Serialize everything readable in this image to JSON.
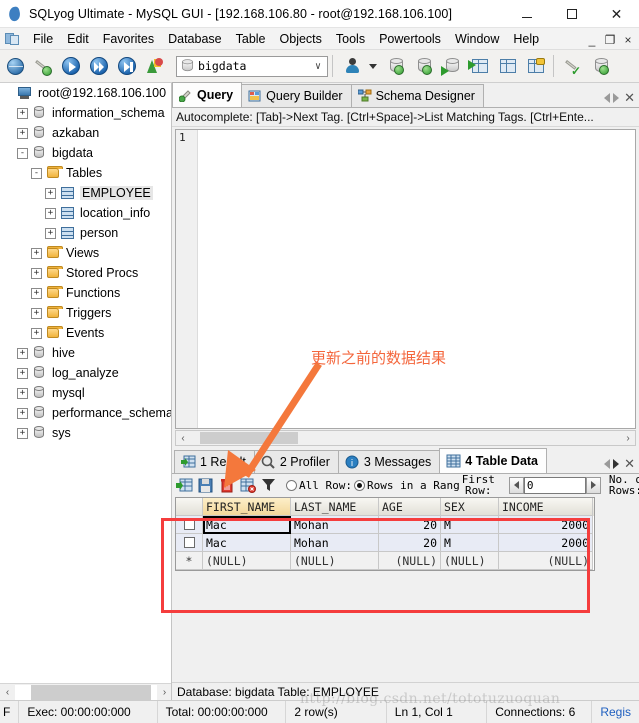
{
  "window": {
    "title": "SQLyog Ultimate - MySQL GUI - [192.168.106.80 - root@192.168.106.100]",
    "app_icon": "dolphin-icon",
    "minimize_label": "–",
    "maximize_label": "□",
    "close_label": "✕"
  },
  "menubar": {
    "doc_icon": "mdi-document-icon",
    "items": [
      {
        "label": "File",
        "name": "menu-file"
      },
      {
        "label": "Edit",
        "name": "menu-edit"
      },
      {
        "label": "Favorites",
        "name": "menu-favorites"
      },
      {
        "label": "Database",
        "name": "menu-database"
      },
      {
        "label": "Table",
        "name": "menu-table"
      },
      {
        "label": "Objects",
        "name": "menu-objects"
      },
      {
        "label": "Tools",
        "name": "menu-tools"
      },
      {
        "label": "Powertools",
        "name": "menu-powertools"
      },
      {
        "label": "Window",
        "name": "menu-window"
      },
      {
        "label": "Help",
        "name": "menu-help"
      }
    ],
    "mdi_minimize": "_",
    "mdi_restore": "❐",
    "mdi_close": "×"
  },
  "toolbar": {
    "database_combo_value": "bigdata",
    "chevron": "∨",
    "icons": [
      "new-connection-icon",
      "new-query-tab-icon",
      "execute-query-icon",
      "execute-all-queries-icon",
      "execute-query-to-file-icon",
      "stop-query-icon"
    ],
    "right_icons": [
      "user-manager-icon",
      "import-data-icon",
      "export-data-icon",
      "backup-database-icon",
      "restore-database-icon",
      "create-table-icon",
      "manage-indexes-icon",
      "sql-formatter-icon",
      "refresh-objects-icon"
    ]
  },
  "tree": {
    "nodes": [
      {
        "label": "root@192.168.106.100",
        "icon": "server-icon",
        "indent": 0,
        "expander": "",
        "selected": false
      },
      {
        "label": "information_schema",
        "icon": "database-icon",
        "indent": 1,
        "expander": "+",
        "selected": false
      },
      {
        "label": "azkaban",
        "icon": "database-icon",
        "indent": 1,
        "expander": "+",
        "selected": false
      },
      {
        "label": "bigdata",
        "icon": "database-icon",
        "indent": 1,
        "expander": "-",
        "selected": false
      },
      {
        "label": "Tables",
        "icon": "folder-icon",
        "indent": 2,
        "expander": "-",
        "selected": false
      },
      {
        "label": "EMPLOYEE",
        "icon": "table-icon",
        "indent": 3,
        "expander": "+",
        "selected": true
      },
      {
        "label": "location_info",
        "icon": "table-icon",
        "indent": 3,
        "expander": "+",
        "selected": false
      },
      {
        "label": "person",
        "icon": "table-icon",
        "indent": 3,
        "expander": "+",
        "selected": false
      },
      {
        "label": "Views",
        "icon": "folder-icon",
        "indent": 2,
        "expander": "+",
        "selected": false
      },
      {
        "label": "Stored Procs",
        "icon": "folder-icon",
        "indent": 2,
        "expander": "+",
        "selected": false
      },
      {
        "label": "Functions",
        "icon": "folder-icon",
        "indent": 2,
        "expander": "+",
        "selected": false
      },
      {
        "label": "Triggers",
        "icon": "folder-icon",
        "indent": 2,
        "expander": "+",
        "selected": false
      },
      {
        "label": "Events",
        "icon": "folder-icon",
        "indent": 2,
        "expander": "+",
        "selected": false
      },
      {
        "label": "hive",
        "icon": "database-icon",
        "indent": 1,
        "expander": "+",
        "selected": false
      },
      {
        "label": "log_analyze",
        "icon": "database-icon",
        "indent": 1,
        "expander": "+",
        "selected": false
      },
      {
        "label": "mysql",
        "icon": "database-icon",
        "indent": 1,
        "expander": "+",
        "selected": false
      },
      {
        "label": "performance_schema",
        "icon": "database-icon",
        "indent": 1,
        "expander": "+",
        "selected": false
      },
      {
        "label": "sys",
        "icon": "database-icon",
        "indent": 1,
        "expander": "+",
        "selected": false
      }
    ],
    "scroll_left_arrow": "‹",
    "scroll_right_arrow": "›"
  },
  "editor_tabs": {
    "tabs": [
      {
        "label": "Query",
        "icon": "query-icon",
        "active": true
      },
      {
        "label": "Query Builder",
        "icon": "query-builder-icon",
        "active": false
      },
      {
        "label": "Schema Designer",
        "icon": "schema-designer-icon",
        "active": false
      }
    ],
    "close_label": "✕"
  },
  "autocomplete_hint": "Autocomplete: [Tab]->Next Tag. [Ctrl+Space]->List Matching Tags. [Ctrl+Ente...",
  "editor": {
    "line_numbers": "1",
    "content": "",
    "scroll_left_arrow": "‹",
    "scroll_right_arrow": "›"
  },
  "result_tabs": {
    "tabs": [
      {
        "label": "1 Result",
        "icon": "result-grid-icon",
        "active": false
      },
      {
        "label": "2 Profiler",
        "icon": "profiler-icon",
        "active": false
      },
      {
        "label": "3 Messages",
        "icon": "messages-icon",
        "active": false
      },
      {
        "label": "4 Table Data",
        "icon": "table-data-icon",
        "active": true
      }
    ],
    "close_label": "✕"
  },
  "grid_toolbar": {
    "icons": [
      "refresh-data-icon",
      "save-changes-icon",
      "delete-row-icon",
      "discard-changes-icon",
      "filter-icon"
    ],
    "all_rows_label": "All Row:",
    "rows_in_range_label": "Rows in a Rang",
    "first_row_label_line1": "First",
    "first_row_label_line2": "Row:",
    "first_row_value": "0",
    "no_of_rows_label_line1": "No. o",
    "no_of_rows_label_line2": "Rows:",
    "spin_left": "◀",
    "spin_right": "▶"
  },
  "datagrid": {
    "columns": [
      "FIRST_NAME",
      "LAST_NAME",
      "AGE",
      "SEX",
      "INCOME"
    ],
    "active_column": "FIRST_NAME",
    "rows": [
      {
        "selector": "checkbox",
        "cells": [
          "Mac",
          "Mohan",
          "20",
          "M",
          "2000"
        ]
      },
      {
        "selector": "checkbox",
        "cells": [
          "Mac",
          "Mohan",
          "20",
          "M",
          "2000"
        ]
      },
      {
        "selector": "*",
        "cells": [
          "(NULL)",
          "(NULL)",
          "(NULL)",
          "(NULL)",
          "(NULL)"
        ]
      }
    ],
    "focused_cell": "Mac"
  },
  "annotation": {
    "text": "更新之前的数据结果",
    "arrow_color": "#f4783c",
    "box_color": "#f53d3d"
  },
  "db_status": "Database: bigdata Table: EMPLOYEE",
  "statusbar": {
    "prefix": "F",
    "exec": "Exec: 00:00:00:000",
    "total": "Total: 00:00:00:000",
    "rows": "2 row(s)",
    "position": "Ln 1, Col 1",
    "connections": "Connections: 6",
    "registration": "Regis"
  },
  "watermark": "http://blog.csdn.net/tototuzuoquan"
}
